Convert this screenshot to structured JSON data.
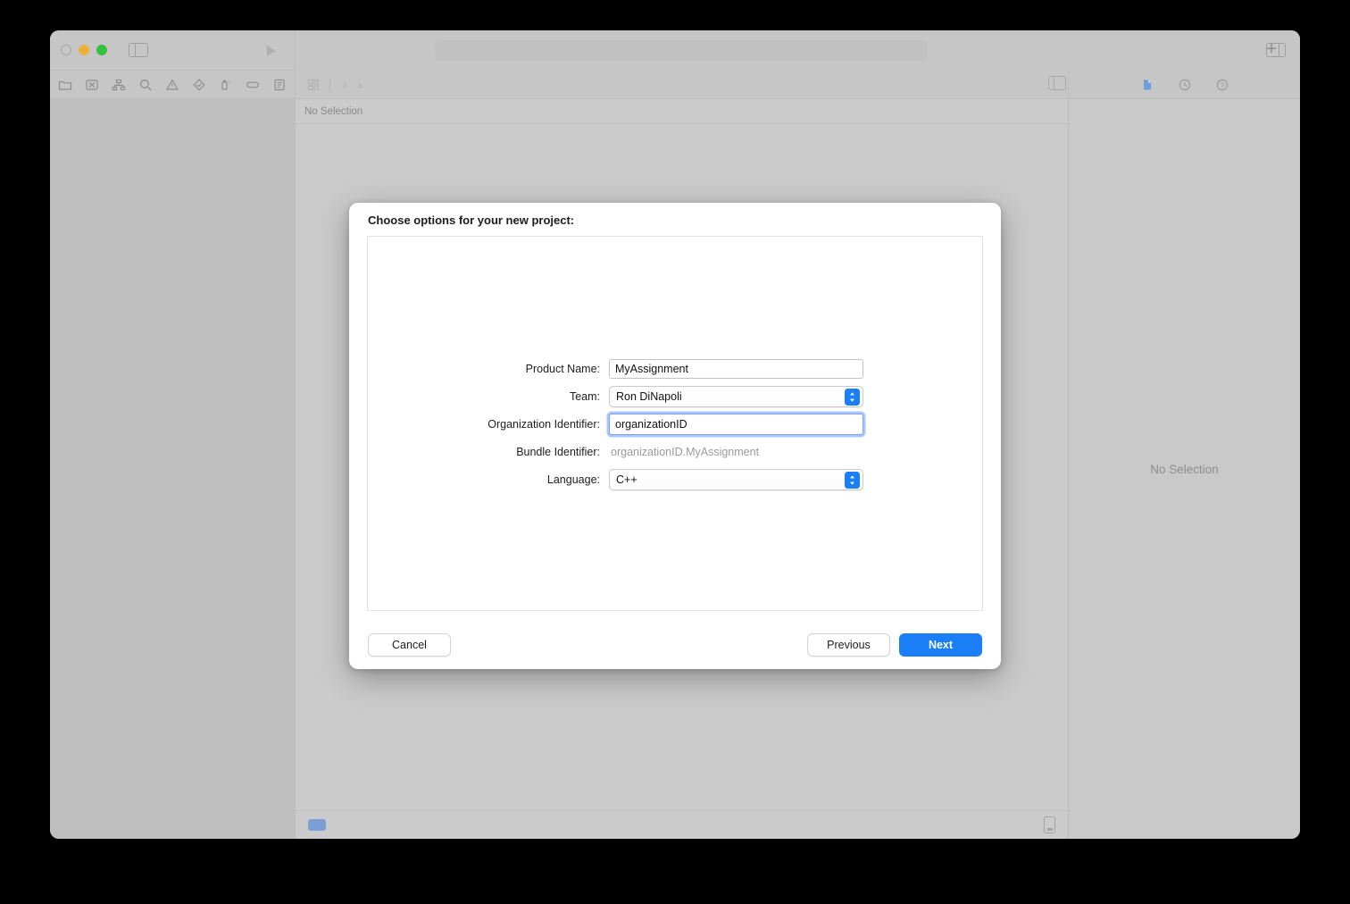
{
  "window": {
    "traffic_lights": [
      "close",
      "minimize",
      "maximize"
    ],
    "run_icon": "play-icon",
    "sidebar_toggle_icon": "sidebar-toggle-icon",
    "inspector_toggle_icon": "inspector-toggle-icon",
    "add_tab_label": "+",
    "navigator_icons": [
      "folder-icon",
      "source-control-icon",
      "symbol-hierarchy-icon",
      "search-icon",
      "warning-triangle-icon",
      "test-diamond-icon",
      "debug-icon",
      "tag-icon",
      "report-list-icon"
    ],
    "editor_bar": {
      "grid_icon": "grid-icon",
      "back_icon": "chevron-left-icon",
      "forward_icon": "chevron-right-icon"
    },
    "inspector_bar_icons": [
      "file-inspector-icon",
      "history-icon",
      "help-icon"
    ],
    "jumpbar_label": "No Selection",
    "inspector_empty_label": "No Selection",
    "statusbar": {
      "chip_icon": "build-status-chip",
      "device_icon": "device-icon"
    }
  },
  "dialog": {
    "title": "Choose options for your new project:",
    "fields": [
      {
        "label": "Product Name:",
        "type": "text",
        "value": "MyAssignment",
        "placeholder": "",
        "focused": false,
        "name": "product-name"
      },
      {
        "label": "Team:",
        "type": "popup",
        "value": "Ron DiNapoli",
        "name": "team"
      },
      {
        "label": "Organization Identifier:",
        "type": "text",
        "value": "organizationID",
        "placeholder": "",
        "focused": true,
        "name": "organization-identifier"
      },
      {
        "label": "Bundle Identifier:",
        "type": "static",
        "value": "organizationID.MyAssignment",
        "name": "bundle-identifier"
      },
      {
        "label": "Language:",
        "type": "popup",
        "value": "C++",
        "name": "language"
      }
    ],
    "buttons": {
      "cancel": "Cancel",
      "previous": "Previous",
      "next": "Next"
    }
  },
  "colors": {
    "accent_blue": "#1a7ef7",
    "focus_ring": "#7aa7f0",
    "window_grey": "#c6c6c6",
    "navigator_grey": "#bfbfbf",
    "editor_grey": "#cbcbcb",
    "muted_text": "#8d8d8d",
    "minimize_yellow": "#e8b13c",
    "maximize_green": "#35c03f"
  }
}
